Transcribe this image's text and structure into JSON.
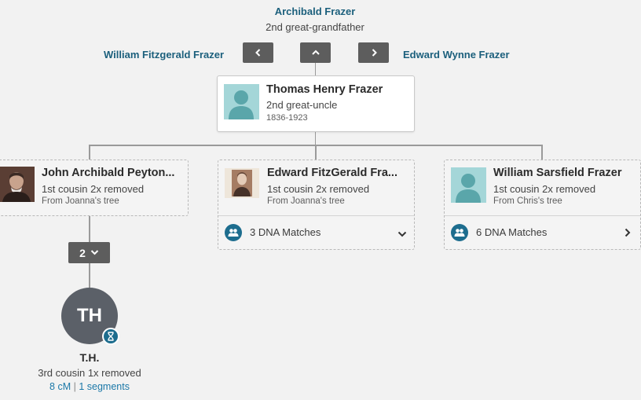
{
  "top_ancestor": {
    "name": "Archibald Frazer",
    "relation": "2nd great-grandfather"
  },
  "nav": {
    "left_sibling": "William Fitzgerald Frazer",
    "right_sibling": "Edward Wynne Frazer"
  },
  "focus": {
    "name": "Thomas Henry Frazer",
    "relation": "2nd great-uncle",
    "years": "1836-1923"
  },
  "children": [
    {
      "name": "John Archibald Peyton...",
      "relation": "1st cousin 2x removed",
      "source": "From Joanna's tree"
    },
    {
      "name": "Edward FitzGerald Fra...",
      "relation": "1st cousin 2x removed",
      "source": "From Joanna's tree",
      "dna": "3 DNA Matches"
    },
    {
      "name": "William Sarsfield Frazer",
      "relation": "1st cousin 2x removed",
      "source": "From Chris's tree",
      "dna": "6 DNA Matches"
    }
  ],
  "generation_toggle": {
    "count": "2"
  },
  "match": {
    "initials": "TH",
    "name": "T.H.",
    "relation": "3rd cousin 1x removed",
    "cm": "8 cM",
    "separator": "|",
    "segments": "1 segments"
  },
  "colors": {
    "link": "#1b5f7c",
    "nav_button": "#5d5d5d",
    "avatar": "#a4d6d8",
    "dna_icon": "#1d6d8e",
    "match_circle": "#5b6068"
  }
}
